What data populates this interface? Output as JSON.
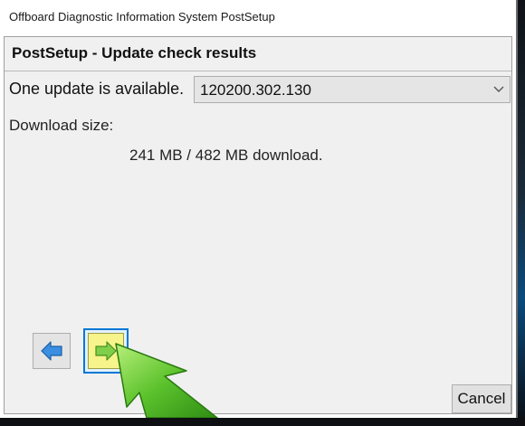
{
  "window": {
    "title": "Offboard Diagnostic Information System PostSetup"
  },
  "header": {
    "title": "PostSetup - Update check results"
  },
  "update": {
    "available_label": "One update is available.",
    "selected_version": "120200.302.130",
    "download_size_label": "Download size:",
    "download_size_value": "241 MB / 482 MB download."
  },
  "navigation": {
    "back_icon": "arrow-left-icon",
    "next_icon": "arrow-right-icon",
    "cancel_label": "Cancel"
  },
  "colors": {
    "accent_blue": "#0078d7",
    "next_highlight": "#f6f48a",
    "arrow_green": "#4fb825"
  }
}
